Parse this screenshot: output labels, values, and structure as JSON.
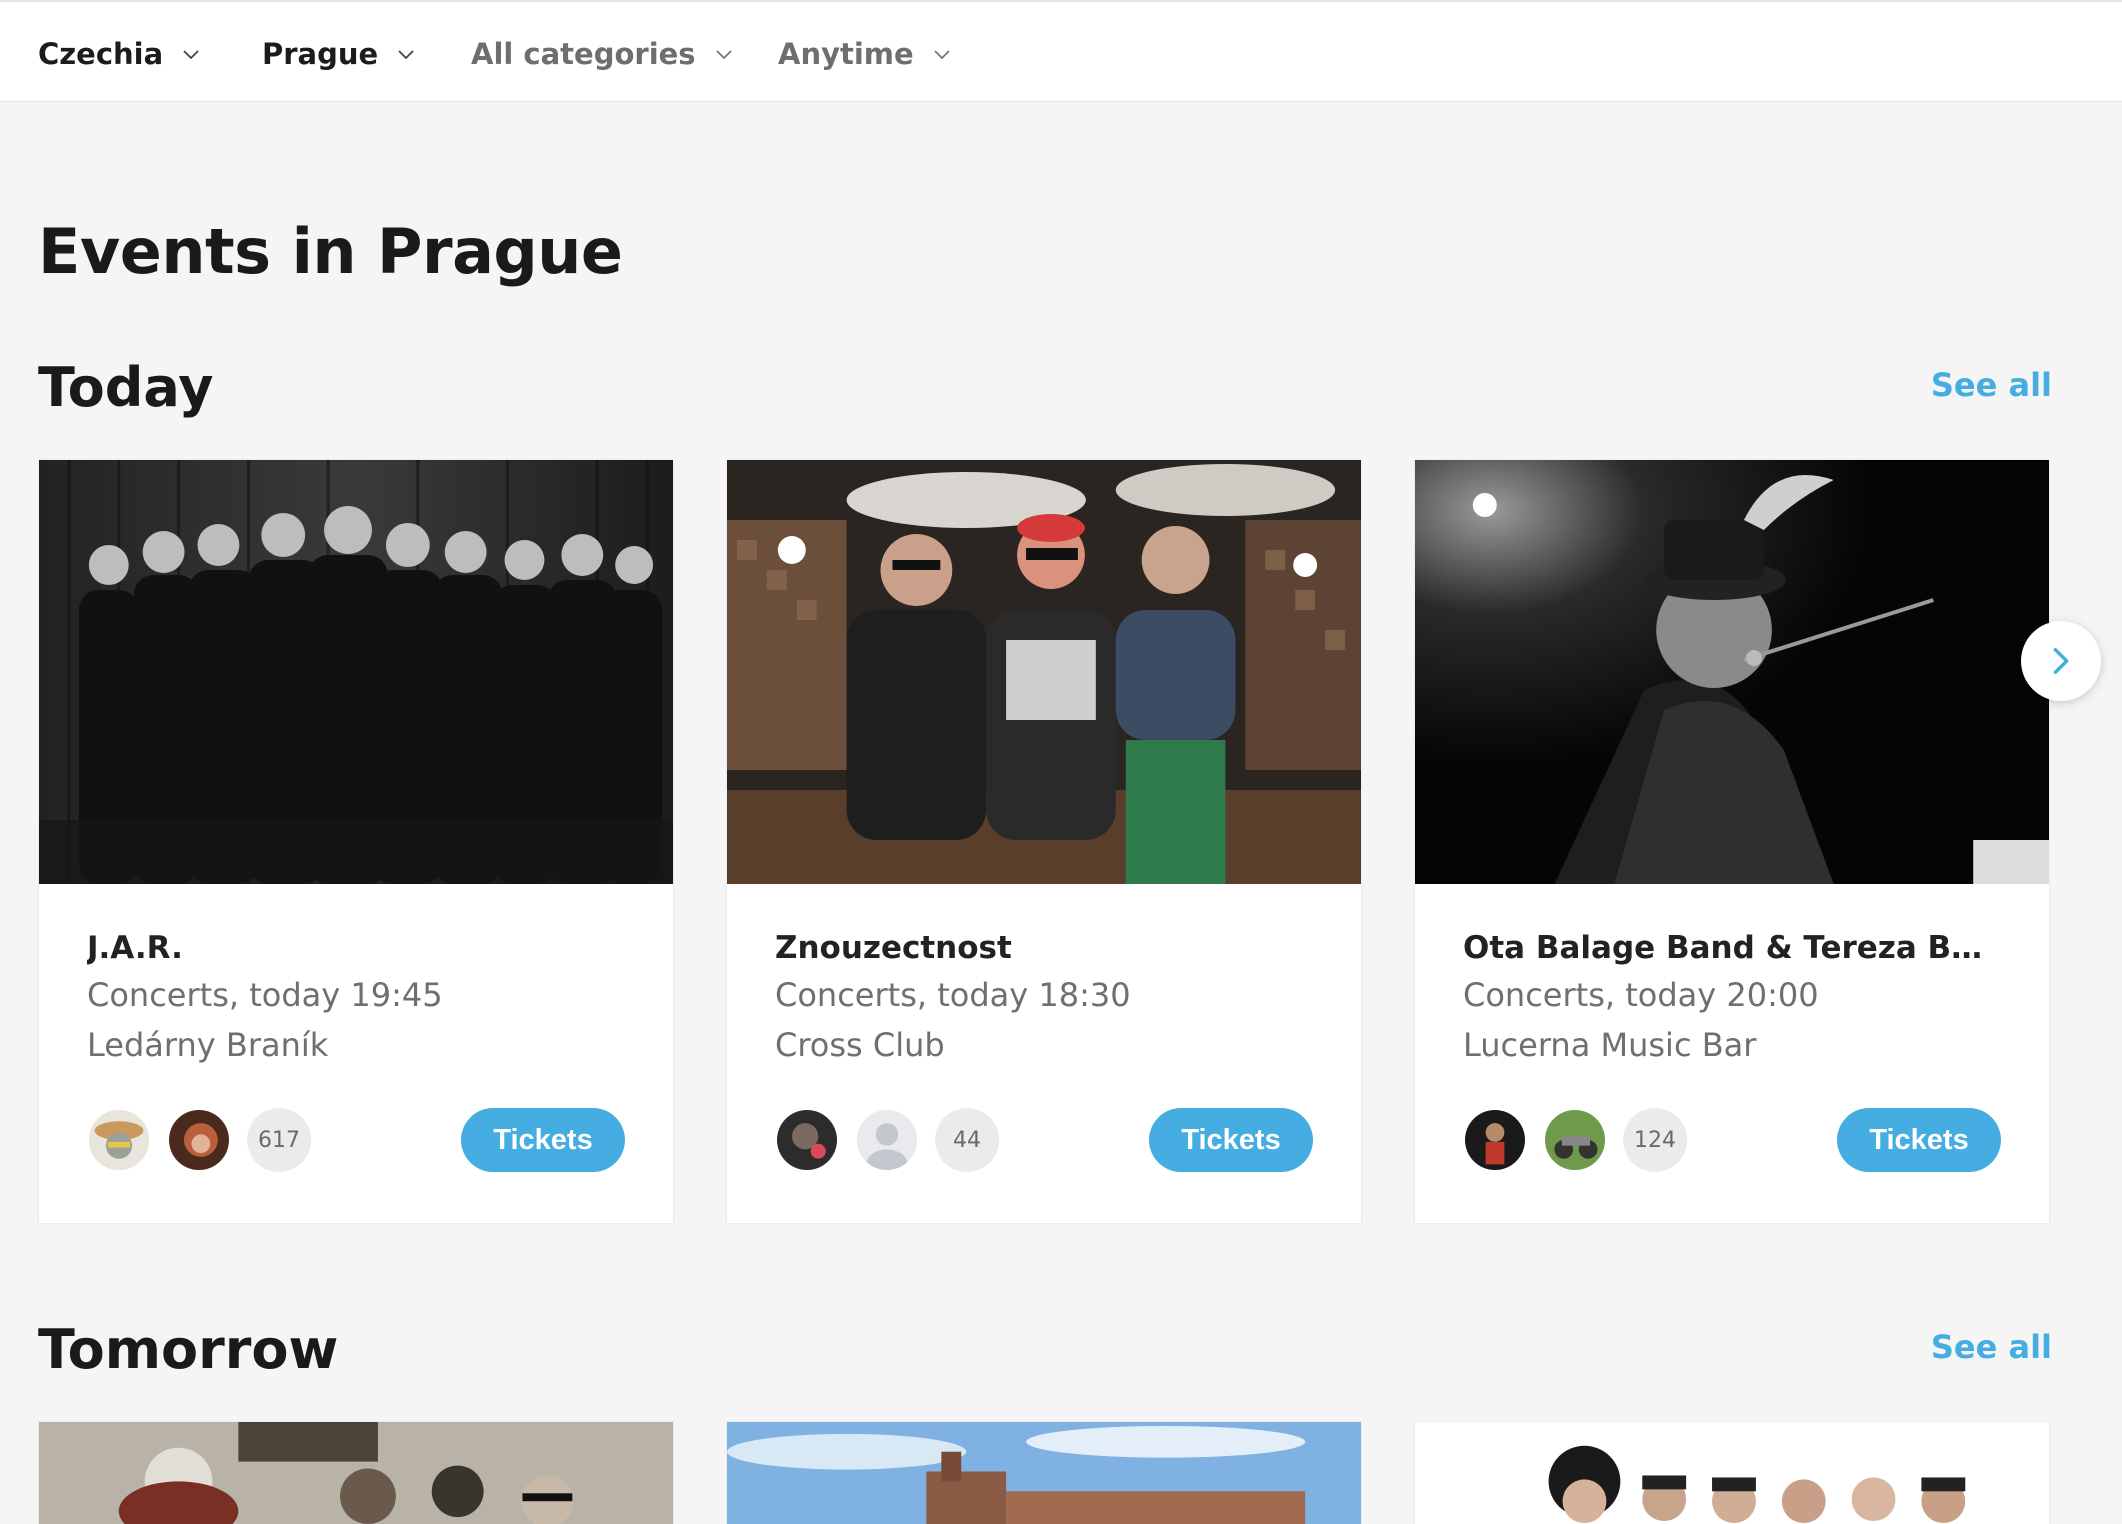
{
  "filters": [
    {
      "label": "Czechia",
      "icon": "chevron-down-icon"
    },
    {
      "label": "Prague",
      "icon": "chevron-down-icon"
    },
    {
      "label": "All categories",
      "icon": "chevron-down-icon"
    },
    {
      "label": "Anytime",
      "icon": "chevron-down-icon"
    }
  ],
  "page_title": "Events in Prague",
  "sections": [
    {
      "title": "Today",
      "see_all": "See all",
      "events": [
        {
          "name": "J.A.R.",
          "when": "Concerts, today 19:45",
          "venue": "Ledárny Braník",
          "attendees": "617",
          "tickets": "Tickets"
        },
        {
          "name": "Znouzectnost",
          "when": "Concerts, today 18:30",
          "venue": "Cross Club",
          "attendees": "44",
          "tickets": "Tickets"
        },
        {
          "name": "Ota Balage Band & Tereza Bareš...",
          "when": "Concerts, today 20:00",
          "venue": "Lucerna Music Bar",
          "attendees": "124",
          "tickets": "Tickets"
        }
      ]
    },
    {
      "title": "Tomorrow",
      "see_all": "See all"
    }
  ],
  "colors": {
    "accent": "#46ade2",
    "background": "#f5f5f5",
    "card": "#ffffff"
  },
  "icons": {
    "next": "chevron-right-icon"
  }
}
